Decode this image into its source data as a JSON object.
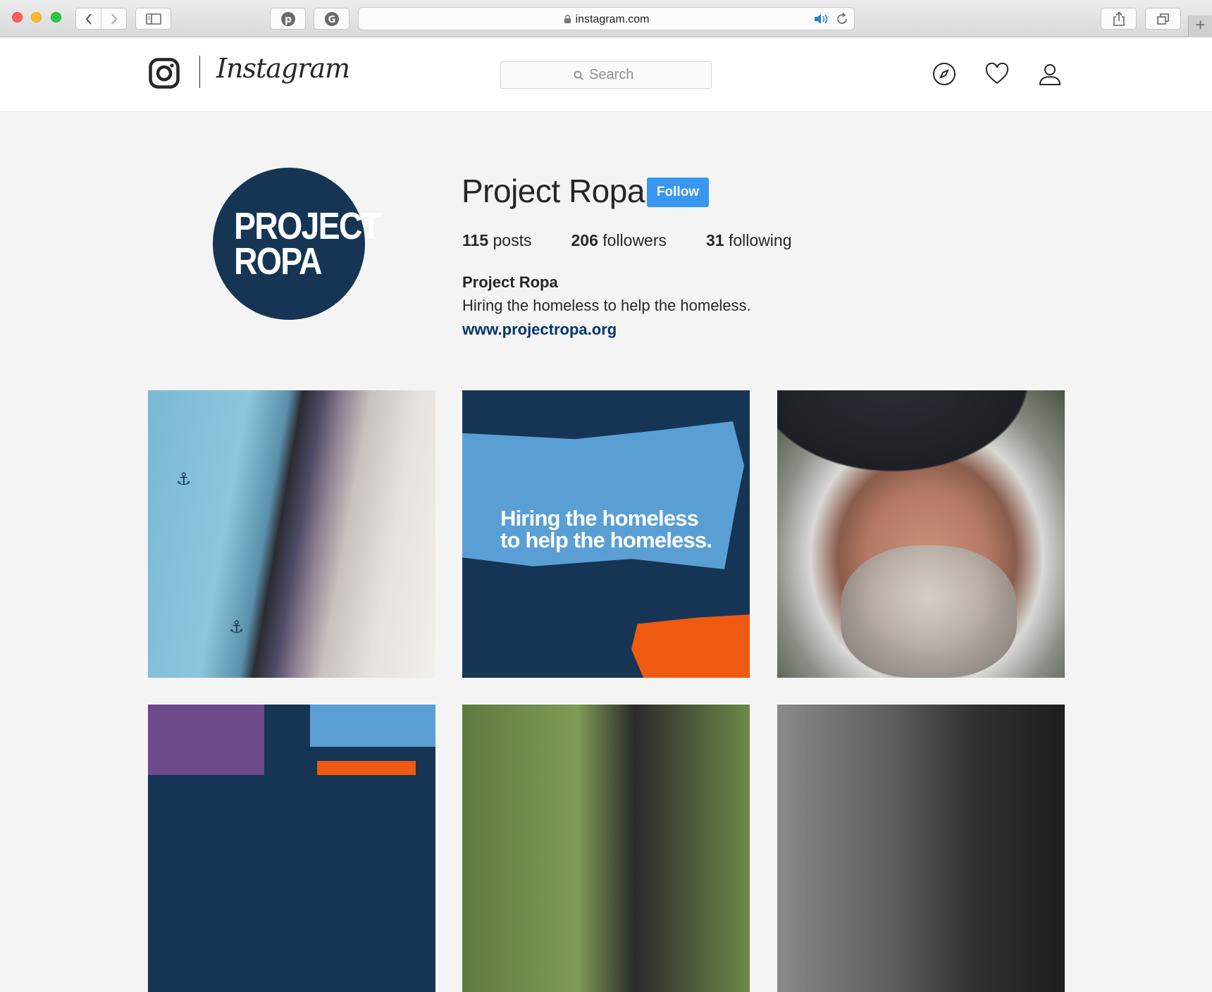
{
  "browser": {
    "url": "instagram.com",
    "new_tab_label": "+"
  },
  "header": {
    "wordmark": "Instagram",
    "search_placeholder": "Search"
  },
  "profile": {
    "username": "Project Ropa",
    "follow_label": "Follow",
    "avatar_line1": "PROJECT",
    "avatar_line2": "ROPA",
    "posts_count": "115",
    "posts_label": "posts",
    "followers_count": "206",
    "followers_label": "followers",
    "following_count": "31",
    "following_label": "following",
    "full_name": "Project Ropa",
    "bio": "Hiring the homeless to help the homeless.",
    "website": "www.projectropa.org"
  },
  "posts": [
    {
      "caption": ""
    },
    {
      "line1": "Hiring the homeless",
      "line2": "to help the homeless."
    },
    {
      "caption": ""
    },
    {
      "caption": ""
    },
    {
      "caption": ""
    },
    {
      "caption": ""
    }
  ],
  "colors": {
    "follow_button": "#3897f0",
    "link": "#003569",
    "brand_navy": "#163555",
    "brush_blue": "#5a9fd4",
    "brush_orange": "#ee5a11"
  }
}
